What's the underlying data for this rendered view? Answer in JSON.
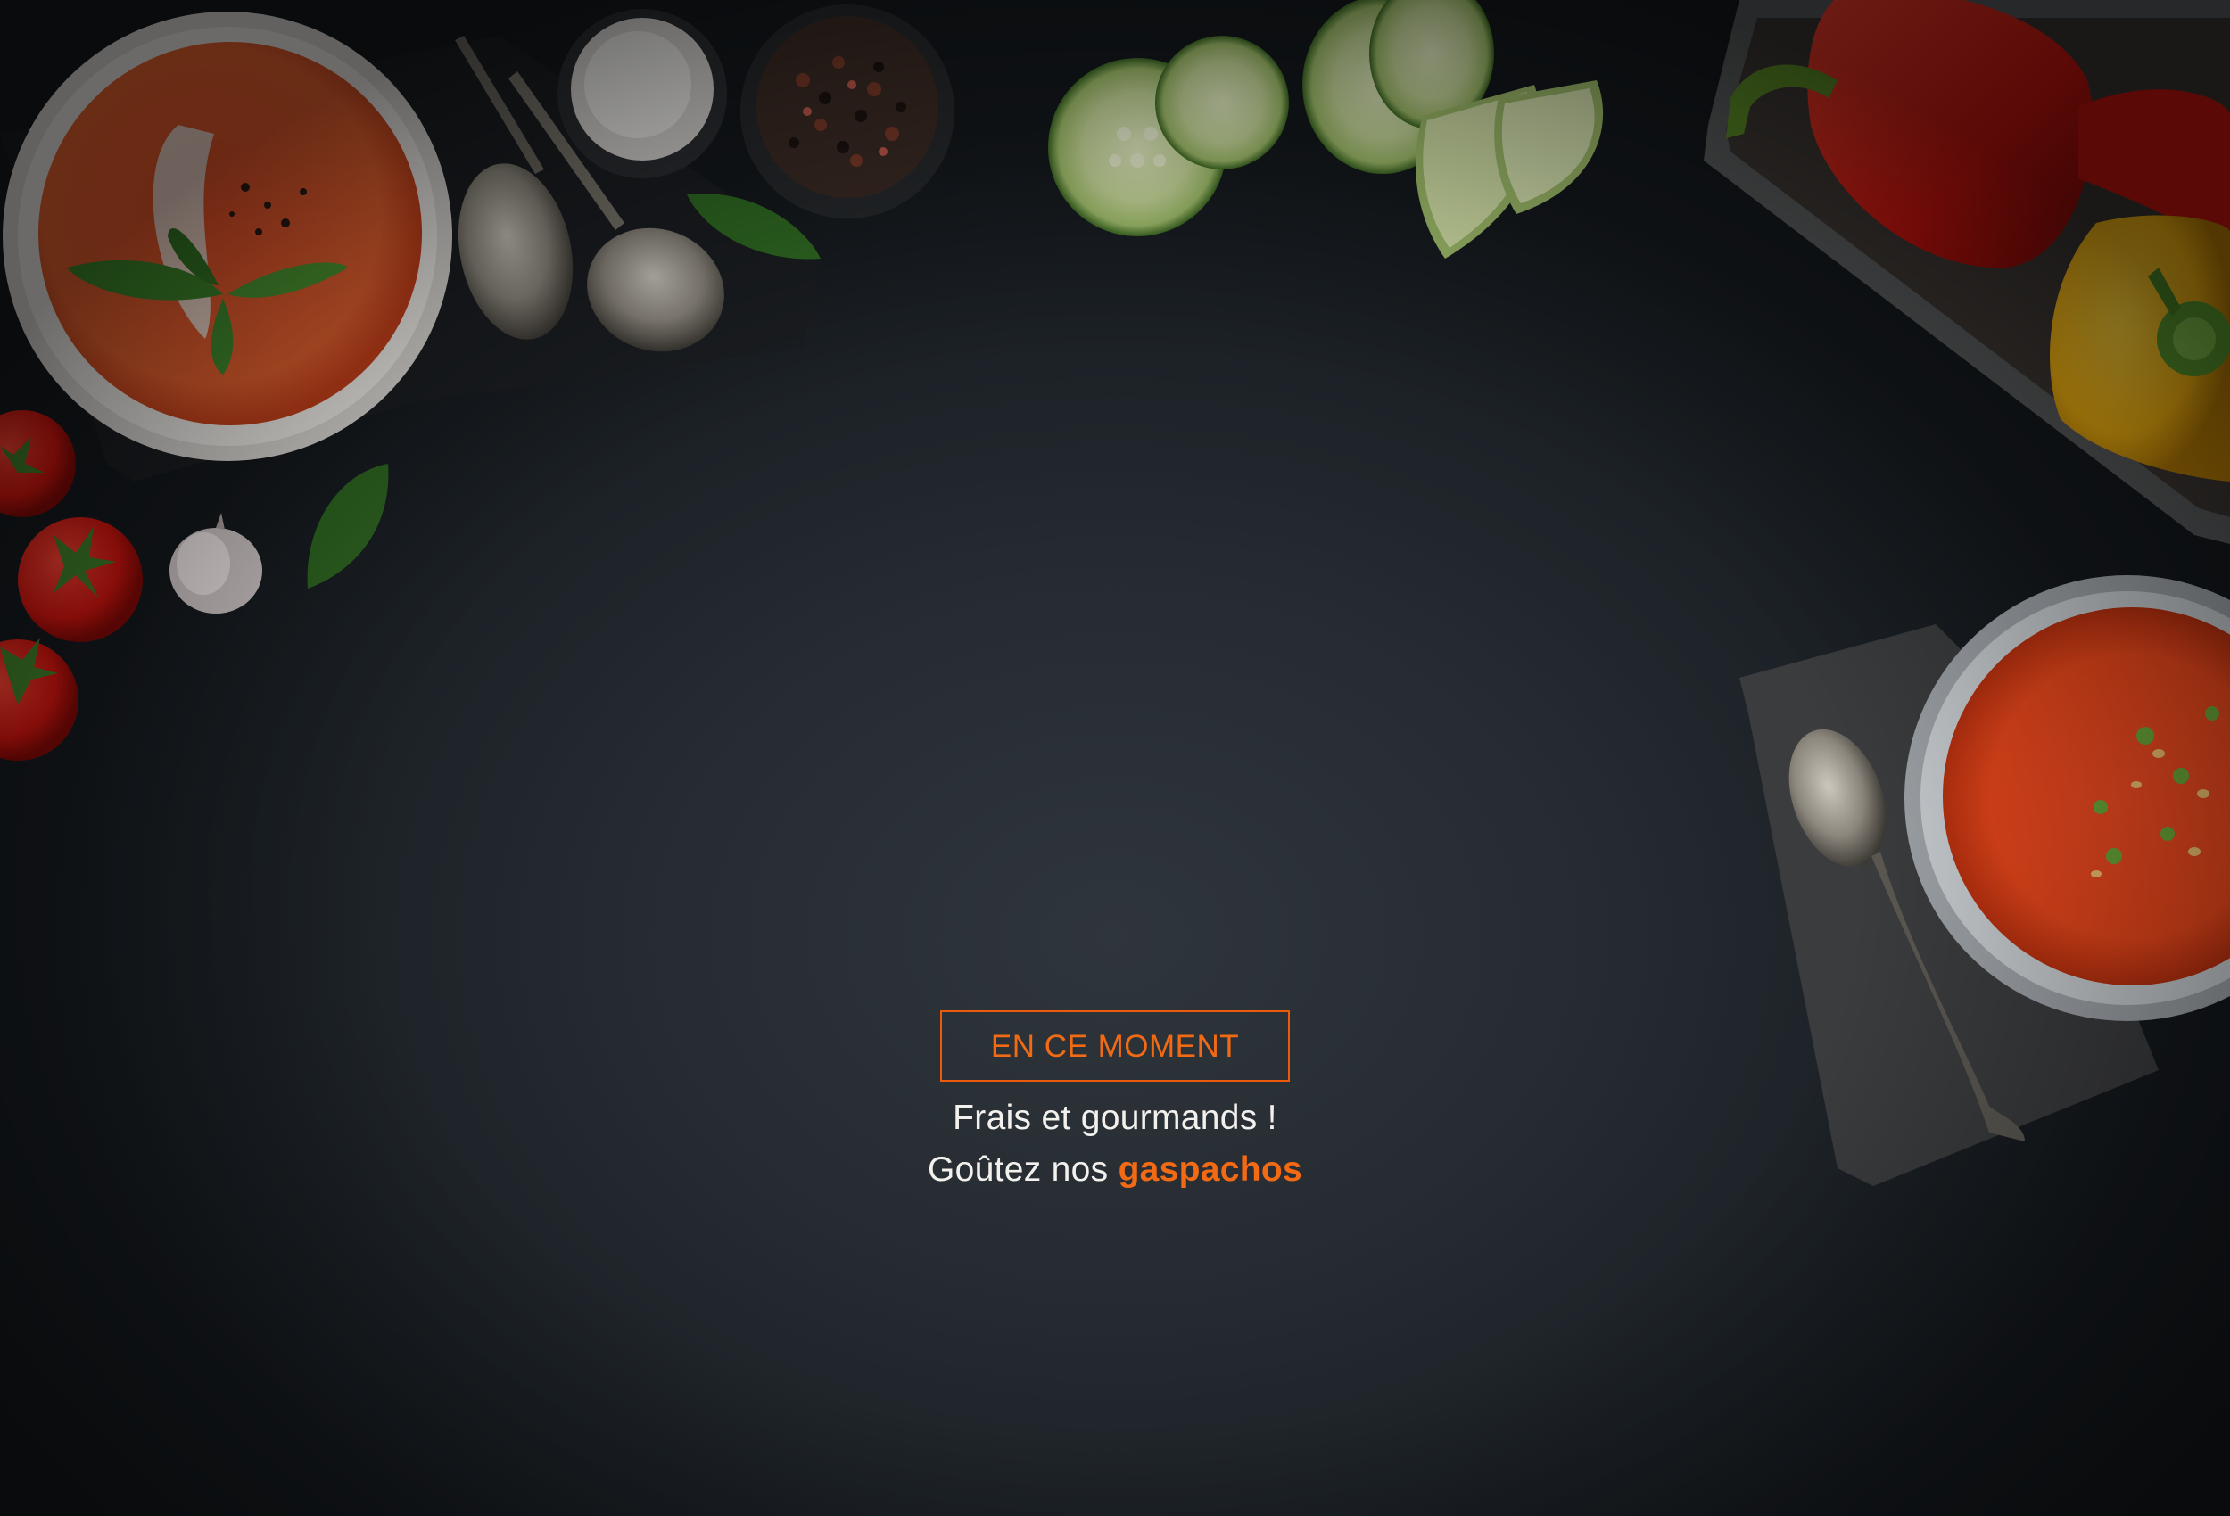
{
  "hero": {
    "badge_label": "EN CE MOMENT",
    "line1": "Frais et gourmands !",
    "line2_prefix": "Goûtez nos ",
    "line2_highlight": "gaspachos"
  },
  "colors": {
    "accent": "#f26a14",
    "background": "#252b31",
    "text": "#f3f1ee"
  },
  "icons": {
    "decor": [
      "gazpacho-bowl-icon",
      "spoon-icon",
      "salt-bowl-icon",
      "peppercorn-bowl-icon",
      "cucumber-slice-icon",
      "bell-pepper-icon",
      "cherry-tomato-icon",
      "garlic-icon",
      "basil-leaf-icon",
      "napkin-icon"
    ]
  }
}
